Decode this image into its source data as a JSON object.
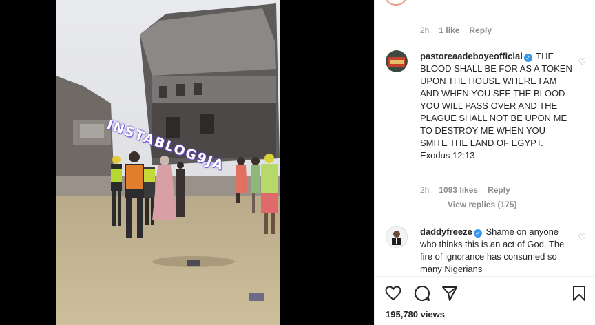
{
  "video": {
    "watermark": "INSTABLOG9JA"
  },
  "comments": {
    "prev_meta": {
      "time": "2h",
      "likes": "1 like",
      "reply": "Reply"
    },
    "items": [
      {
        "username": "pastoreaadeboyeofficial",
        "text": "THE BLOOD SHALL BE FOR AS A TOKEN UPON THE HOUSE WHERE I AM AND WHEN YOU SEE THE BLOOD YOU WILL PASS OVER AND THE PLAGUE SHALL NOT BE UPON ME TO DESTROY ME WHEN YOU SMITE THE LAND OF EGYPT.",
        "text2": "Exodus 12:13",
        "time": "2h",
        "likes": "1093 likes",
        "reply": "Reply",
        "view_replies": "View replies (175)"
      },
      {
        "username": "daddyfreeze",
        "text": "Shame on anyone who thinks this is an act of God. The fire of ignorance has consumed so many Nigerians"
      }
    ]
  },
  "post": {
    "views": "195,780 views"
  },
  "icons": {
    "like": "heart-icon",
    "comment": "comment-icon",
    "share": "share-icon",
    "save": "bookmark-icon",
    "verified": "verified-badge-icon"
  },
  "colors": {
    "verified": "#3897f0",
    "muted": "#8e8e8e",
    "text": "#262626"
  }
}
